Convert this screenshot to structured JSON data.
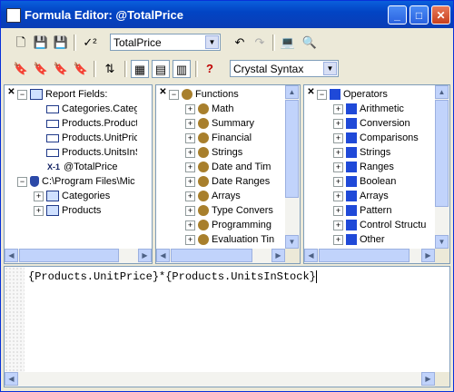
{
  "window": {
    "title": "Formula Editor: @TotalPrice",
    "app_icon": "icon",
    "controls": {
      "minimize": "_",
      "maximize": "□",
      "close": "✕"
    }
  },
  "toolbar1": {
    "icons": {
      "new": "🗋",
      "save": "💾",
      "save_as": "💾",
      "check": "✓²",
      "undo": "↶",
      "redo": "↷",
      "browse": "💻",
      "find": "🔍"
    },
    "formula_name": "TotalPrice"
  },
  "toolbar2": {
    "icons": {
      "bookmark": "🔖",
      "next_bookmark": "🔖",
      "prev_bookmark": "🔖",
      "clear_bookmarks": "🔖",
      "sort": "⇅",
      "toggle_fields": "▦",
      "toggle_functions": "▤",
      "toggle_operators": "▥",
      "help": "?"
    },
    "syntax": "Crystal Syntax"
  },
  "panes": {
    "fields": {
      "items": [
        {
          "label": "Report Fields:",
          "expander": "−"
        },
        {
          "label": "Categories.Catego"
        },
        {
          "label": "Products.Product"
        },
        {
          "label": "Products.UnitPric"
        },
        {
          "label": "Products.UnitsInS"
        },
        {
          "label": "@TotalPrice",
          "icon": "X-1"
        },
        {
          "label": "C:\\Program Files\\Mic",
          "expander": "−"
        },
        {
          "label": "Categories",
          "expander": "+"
        },
        {
          "label": "Products",
          "expander": "+"
        }
      ]
    },
    "functions": {
      "items": [
        {
          "label": "Functions",
          "expander": "−"
        },
        {
          "label": "Math",
          "expander": "+"
        },
        {
          "label": "Summary",
          "expander": "+"
        },
        {
          "label": "Financial",
          "expander": "+"
        },
        {
          "label": "Strings",
          "expander": "+"
        },
        {
          "label": "Date and Tim",
          "expander": "+"
        },
        {
          "label": "Date Ranges",
          "expander": "+"
        },
        {
          "label": "Arrays",
          "expander": "+"
        },
        {
          "label": "Type Convers",
          "expander": "+"
        },
        {
          "label": "Programming",
          "expander": "+"
        },
        {
          "label": "Evaluation Tin",
          "expander": "+"
        }
      ]
    },
    "operators": {
      "items": [
        {
          "label": "Operators",
          "expander": "−"
        },
        {
          "label": "Arithmetic",
          "expander": "+"
        },
        {
          "label": "Conversion",
          "expander": "+"
        },
        {
          "label": "Comparisons",
          "expander": "+"
        },
        {
          "label": "Strings",
          "expander": "+"
        },
        {
          "label": "Ranges",
          "expander": "+"
        },
        {
          "label": "Boolean",
          "expander": "+"
        },
        {
          "label": "Arrays",
          "expander": "+"
        },
        {
          "label": "Pattern",
          "expander": "+"
        },
        {
          "label": "Control Structu",
          "expander": "+"
        },
        {
          "label": "Other",
          "expander": "+"
        }
      ]
    },
    "close_glyph": "✕",
    "arrows": {
      "up": "▲",
      "down": "▼",
      "left": "◀",
      "right": "▶"
    },
    "combo_arrow": "▼"
  },
  "editor": {
    "formula": "{Products.UnitPrice}*{Products.UnitsInStock}"
  }
}
